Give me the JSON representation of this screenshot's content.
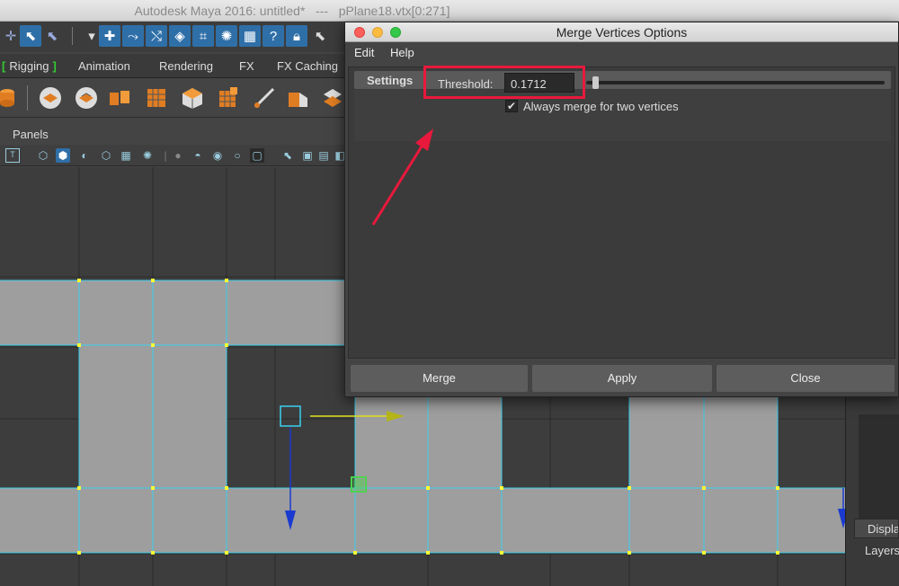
{
  "window": {
    "title": "Autodesk Maya 2016: untitled*   ---   pPlane18.vtx[0:271]"
  },
  "toolbar": {
    "icons": [
      "select-tool-icon",
      "lasso-icon",
      "paint-select-icon",
      "move-icon",
      "rotate-icon",
      "scale-icon",
      "snap-grid-icon",
      "snap-curve-icon",
      "snap-point-icon",
      "snap-surface-icon",
      "camera-icon",
      "help-icon",
      "lock-icon",
      "select-icon"
    ]
  },
  "shelf": {
    "tabs": [
      "Rigging",
      "Animation",
      "Rendering",
      "FX",
      "FX Caching"
    ]
  },
  "panels": {
    "menu_label": "Panels"
  },
  "dialog": {
    "title": "Merge Vertices Options",
    "menu": {
      "edit": "Edit",
      "help": "Help"
    },
    "frame_title": "Settings",
    "threshold_label": "Threshold:",
    "threshold_value": "0.1712",
    "threshold_slider_fraction": 0.02,
    "checkbox_label": "Always merge for two vertices",
    "checkbox_checked": "✔",
    "buttons": {
      "merge": "Merge",
      "apply": "Apply",
      "close": "Close"
    }
  },
  "right_panel": {
    "display_tab": "Display",
    "layers_label": "Layers"
  },
  "colors": {
    "highlight": "#e8193c",
    "selection_blue": "#2f6fa8",
    "mesh_edge": "#3ad0f0",
    "vertex": "#ffff33"
  }
}
